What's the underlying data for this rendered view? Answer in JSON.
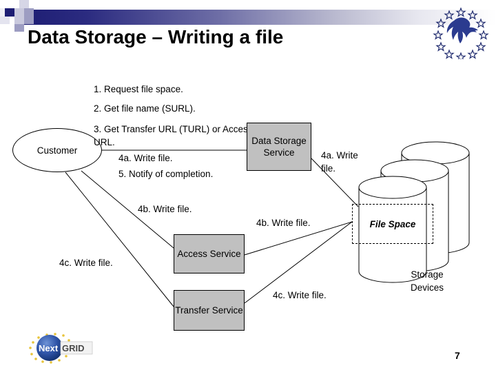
{
  "slide": {
    "title": "Data Storage – Writing a file",
    "page_number": "7"
  },
  "branding": {
    "eu_logo_name": "eu-stars-globe-logo",
    "nextgrid_logo_text_left": "Next",
    "nextgrid_logo_text_right": "GRID",
    "accent_navy": "#1d1d73",
    "node_fill": "#c0c0c0"
  },
  "diagram": {
    "steps": {
      "step1": "1. Request file space.",
      "step2": "2. Get file name (SURL).",
      "step3": "3. Get Transfer URL (TURL) or Access URL.",
      "step4a_center": "4a. Write file.",
      "step5": "5. Notify of completion.",
      "step4b_left": "4b. Write file.",
      "step4c_left": "4c. Write file.",
      "step4a_right": "4a. Write file.",
      "step4b_right": "4b. Write file.",
      "step4c_right": "4c. Write file."
    },
    "nodes": {
      "customer": "Customer",
      "data_storage_service": "Data Storage Service",
      "access_service": "Access Service",
      "transfer_service": "Transfer Service",
      "file_space": "File Space",
      "storage_devices": "Storage Devices"
    }
  }
}
